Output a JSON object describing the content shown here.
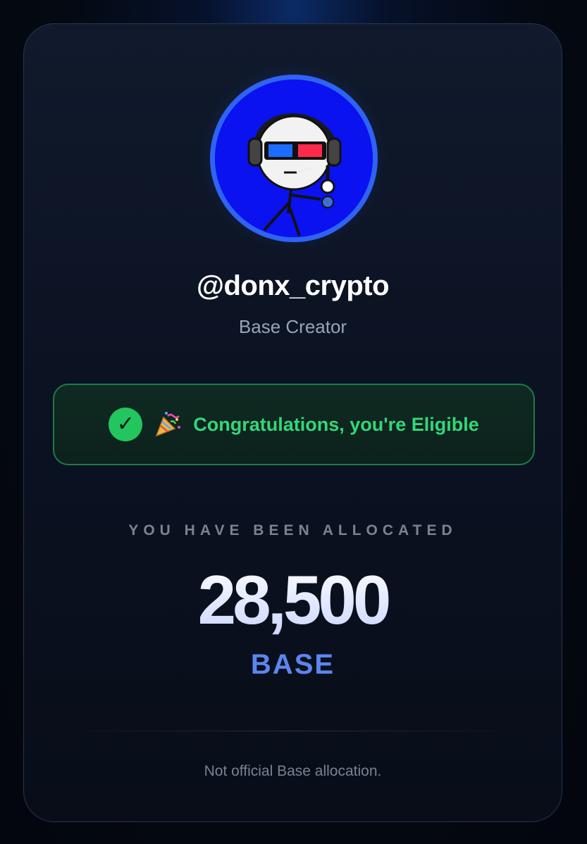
{
  "profile": {
    "username": "@donx_crypto",
    "role": "Base Creator"
  },
  "status": {
    "message": "Congratulations, you're Eligible",
    "check_symbol": "✓"
  },
  "allocation": {
    "label": "YOU HAVE BEEN ALLOCATED",
    "amount": "28,500",
    "token": "BASE"
  },
  "footer": {
    "disclaimer": "Not official Base allocation."
  },
  "colors": {
    "accent_blue": "#5b86f0",
    "success_green": "#34d67a",
    "avatar_ring": "#2f63f3"
  }
}
